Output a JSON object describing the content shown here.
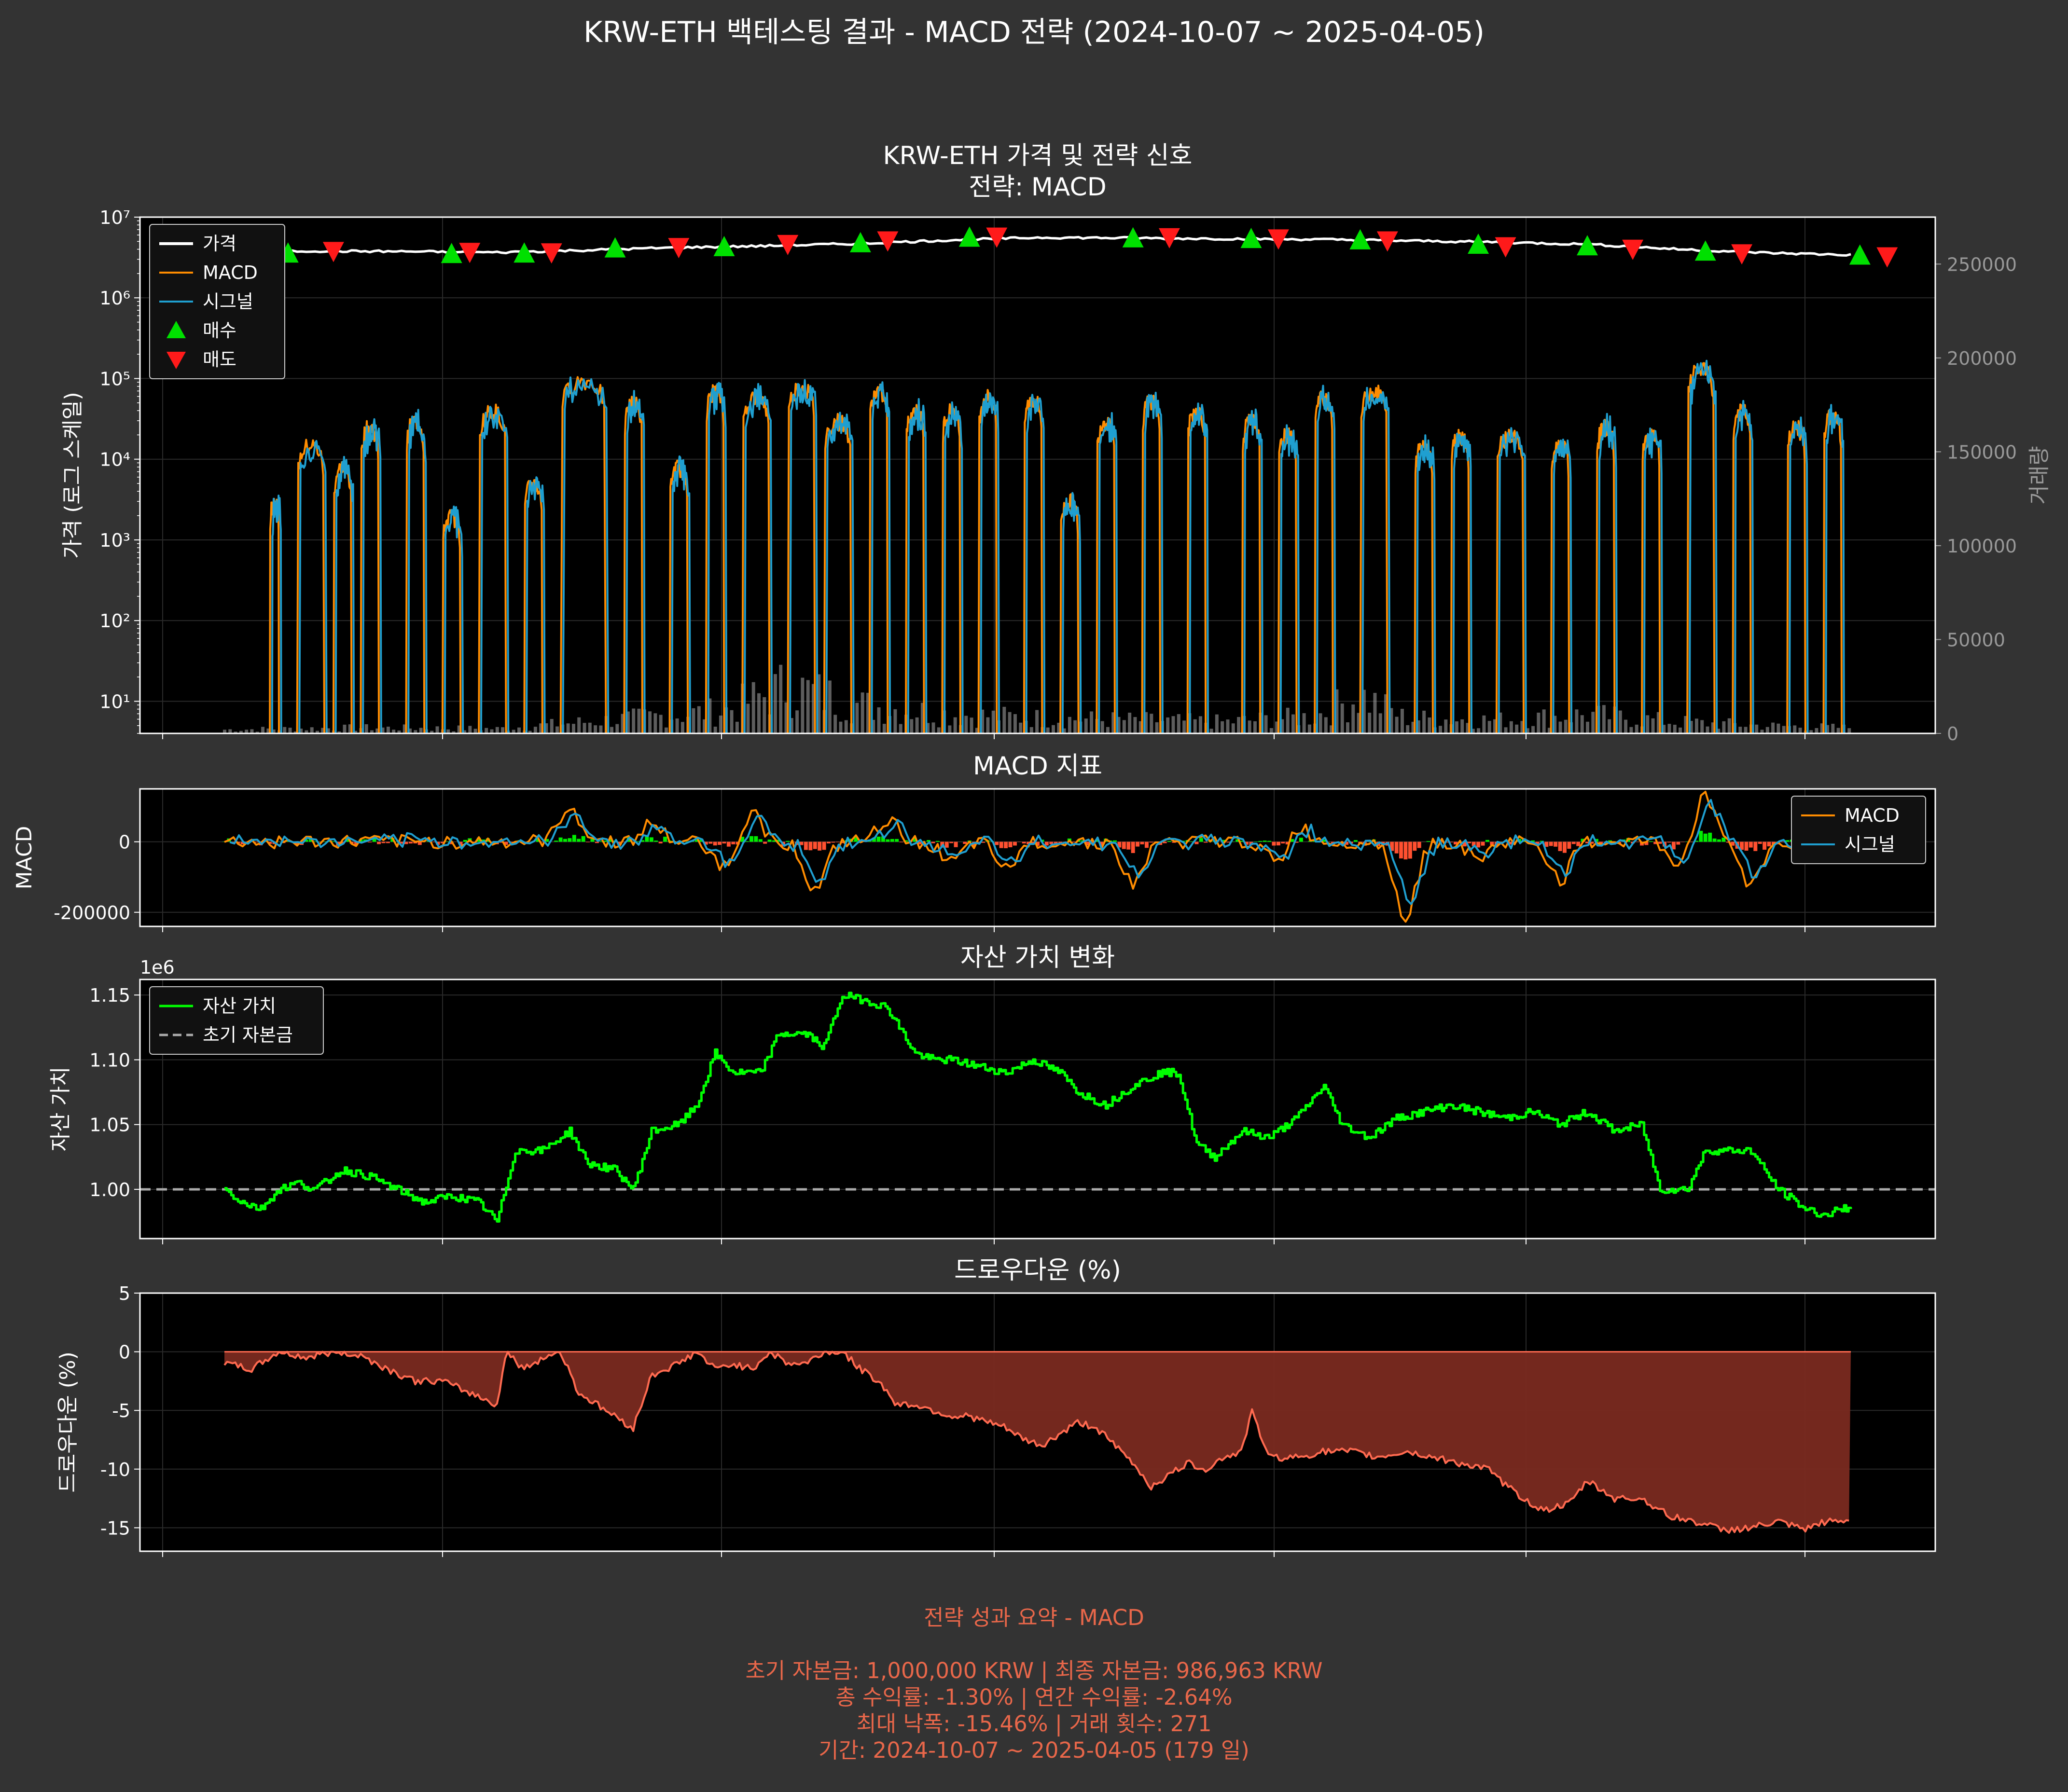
{
  "figure": {
    "title": "KRW-ETH 백테스팅 결과 - MACD 전략 (2024-10-07 ~ 2025-04-05)",
    "background": "#333333",
    "axes_background": "#000000"
  },
  "colors": {
    "price": "#ffffff",
    "macd": "#ff8c00",
    "signal": "#1f9fd0",
    "buy": "#00e000",
    "sell": "#ff1a1a",
    "equity": "#00ff00",
    "initial_capital": "#aaaaaa",
    "drawdown_line": "#ff6a50",
    "drawdown_fill": "#7a2a20",
    "hist_pos": "#00ee00",
    "hist_neg": "#ff5030",
    "volume": "#aaaaaa",
    "summary_text": "#e8674a"
  },
  "chart_data": [
    {
      "type": "line",
      "id": "price",
      "title_line1": "KRW-ETH 가격 및 전략 신호",
      "title_line2": "전략: MACD",
      "ylabel": "가격 (로그 스케일)",
      "y2label": "거래량",
      "yscale": "log",
      "ylim": [
        4,
        10000000
      ],
      "y_ticks": [
        10,
        100,
        1000,
        10000,
        100000,
        1000000,
        10000000
      ],
      "y_tick_labels": [
        "10¹",
        "10²",
        "10³",
        "10⁴",
        "10⁵",
        "10⁶",
        "10⁷"
      ],
      "y2lim": [
        0,
        275000
      ],
      "y2_ticks": [
        0,
        50000,
        100000,
        150000,
        200000,
        250000
      ],
      "y2_tick_labels": [
        "0",
        "50000",
        "100000",
        "150000",
        "200000",
        "250000"
      ],
      "legend": [
        "가격",
        "MACD",
        "시그널",
        "매수",
        "매도"
      ],
      "legend_position": "upper-left",
      "grid": true,
      "x_range": [
        0,
        179
      ],
      "price_series": [
        [
          0,
          3700000
        ],
        [
          10,
          3800000
        ],
        [
          20,
          3750000
        ],
        [
          30,
          3650000
        ],
        [
          40,
          3900000
        ],
        [
          50,
          4200000
        ],
        [
          60,
          4400000
        ],
        [
          70,
          4700000
        ],
        [
          80,
          5200000
        ],
        [
          90,
          5600000
        ],
        [
          100,
          5500000
        ],
        [
          110,
          5400000
        ],
        [
          120,
          5300000
        ],
        [
          130,
          5100000
        ],
        [
          140,
          4900000
        ],
        [
          150,
          4600000
        ],
        [
          160,
          4000000
        ],
        [
          170,
          3600000
        ],
        [
          179,
          3400000
        ]
      ],
      "buy_signals": [
        [
          7,
          3500000
        ],
        [
          25,
          3450000
        ],
        [
          33,
          3500000
        ],
        [
          43,
          4050000
        ],
        [
          55,
          4200000
        ],
        [
          70,
          4700000
        ],
        [
          82,
          5500000
        ],
        [
          100,
          5400000
        ],
        [
          113,
          5300000
        ],
        [
          125,
          5100000
        ],
        [
          138,
          4500000
        ],
        [
          150,
          4300000
        ],
        [
          163,
          3700000
        ],
        [
          180,
          3300000
        ]
      ],
      "sell_signals": [
        [
          12,
          3850000
        ],
        [
          27,
          3750000
        ],
        [
          36,
          3700000
        ],
        [
          50,
          4300000
        ],
        [
          62,
          4700000
        ],
        [
          73,
          5200000
        ],
        [
          85,
          5800000
        ],
        [
          104,
          5700000
        ],
        [
          116,
          5500000
        ],
        [
          128,
          5200000
        ],
        [
          141,
          4400000
        ],
        [
          155,
          4100000
        ],
        [
          167,
          3600000
        ],
        [
          183,
          3300000
        ]
      ],
      "macd_bursts": [
        [
          5,
          6,
          3000
        ],
        [
          8,
          11,
          15000
        ],
        [
          12,
          14,
          8000
        ],
        [
          15,
          17,
          25000
        ],
        [
          20,
          22,
          30000
        ],
        [
          24,
          26,
          2000
        ],
        [
          28,
          31,
          40000
        ],
        [
          33,
          35,
          5000
        ],
        [
          37,
          42,
          95000
        ],
        [
          44,
          46,
          50000
        ],
        [
          49,
          51,
          8000
        ],
        [
          53,
          55,
          70000
        ],
        [
          57,
          60,
          60000
        ],
        [
          62,
          65,
          80000
        ],
        [
          66,
          69,
          30000
        ],
        [
          71,
          73,
          70000
        ],
        [
          75,
          77,
          40000
        ],
        [
          79,
          81,
          40000
        ],
        [
          83,
          85,
          60000
        ],
        [
          88,
          90,
          55000
        ],
        [
          92,
          94,
          3000
        ],
        [
          96,
          98,
          30000
        ],
        [
          101,
          103,
          55000
        ],
        [
          106,
          108,
          40000
        ],
        [
          112,
          114,
          30000
        ],
        [
          116,
          118,
          20000
        ],
        [
          120,
          122,
          60000
        ],
        [
          125,
          128,
          70000
        ],
        [
          131,
          133,
          15000
        ],
        [
          135,
          137,
          20000
        ],
        [
          140,
          143,
          20000
        ],
        [
          146,
          148,
          15000
        ],
        [
          151,
          153,
          25000
        ],
        [
          156,
          158,
          20000
        ],
        [
          161,
          164,
          130000
        ],
        [
          166,
          168,
          40000
        ],
        [
          172,
          174,
          25000
        ],
        [
          176,
          178,
          35000
        ]
      ],
      "volume_profile": [
        [
          0,
          2000
        ],
        [
          15,
          3000
        ],
        [
          30,
          2500
        ],
        [
          45,
          8000
        ],
        [
          55,
          12000
        ],
        [
          62,
          25000
        ],
        [
          70,
          15000
        ],
        [
          80,
          10000
        ],
        [
          90,
          8000
        ],
        [
          100,
          7000
        ],
        [
          110,
          6000
        ],
        [
          120,
          9000
        ],
        [
          125,
          20000
        ],
        [
          130,
          8000
        ],
        [
          140,
          7000
        ],
        [
          150,
          10000
        ],
        [
          160,
          6000
        ],
        [
          170,
          4000
        ],
        [
          179,
          3000
        ]
      ]
    },
    {
      "type": "line",
      "id": "macd",
      "title": "MACD 지표",
      "ylabel": "MACD",
      "ylim": [
        -240000,
        150000
      ],
      "y_ticks": [
        0,
        -200000
      ],
      "y_tick_labels": [
        "0",
        "-200000"
      ],
      "legend": [
        "MACD",
        "시그널"
      ],
      "legend_position": "upper-right",
      "grid": true,
      "extremes": [
        [
          38,
          100000
        ],
        [
          47,
          50000
        ],
        [
          55,
          -70000
        ],
        [
          58,
          80000
        ],
        [
          65,
          -140000
        ],
        [
          73,
          60000
        ],
        [
          80,
          -60000
        ],
        [
          86,
          -80000
        ],
        [
          100,
          -120000
        ],
        [
          116,
          -70000
        ],
        [
          118,
          50000
        ],
        [
          130,
          -215000
        ],
        [
          138,
          -50000
        ],
        [
          147,
          -110000
        ],
        [
          160,
          -60000
        ],
        [
          163,
          130000
        ],
        [
          168,
          -120000
        ],
        [
          178,
          40000
        ]
      ]
    },
    {
      "type": "line",
      "id": "equity",
      "title": "자산 가치 변화",
      "ylabel": "자산 가치",
      "offset_label": "1e6",
      "ylim": [
        0.962,
        1.162
      ],
      "y_ticks": [
        1.0,
        1.05,
        1.1,
        1.15
      ],
      "y_tick_labels": [
        "1.00",
        "1.05",
        "1.10",
        "1.15"
      ],
      "legend": [
        "자산 가치",
        "초기 자본금"
      ],
      "legend_position": "upper-left",
      "initial_capital": 1.0,
      "grid": true,
      "series": [
        [
          0,
          1.0
        ],
        [
          2,
          0.99
        ],
        [
          4,
          0.985
        ],
        [
          6,
          1.0
        ],
        [
          8,
          1.005
        ],
        [
          10,
          1.0
        ],
        [
          13,
          1.015
        ],
        [
          16,
          1.01
        ],
        [
          19,
          1.0
        ],
        [
          22,
          0.99
        ],
        [
          25,
          0.995
        ],
        [
          28,
          0.99
        ],
        [
          30,
          0.975
        ],
        [
          32,
          1.03
        ],
        [
          35,
          1.03
        ],
        [
          38,
          1.045
        ],
        [
          40,
          1.02
        ],
        [
          43,
          1.015
        ],
        [
          45,
          1.0
        ],
        [
          47,
          1.045
        ],
        [
          50,
          1.05
        ],
        [
          52,
          1.065
        ],
        [
          54,
          1.105
        ],
        [
          56,
          1.09
        ],
        [
          59,
          1.09
        ],
        [
          61,
          1.12
        ],
        [
          64,
          1.12
        ],
        [
          66,
          1.11
        ],
        [
          68,
          1.15
        ],
        [
          71,
          1.145
        ],
        [
          73,
          1.14
        ],
        [
          76,
          1.105
        ],
        [
          78,
          1.1
        ],
        [
          80,
          1.1
        ],
        [
          83,
          1.095
        ],
        [
          86,
          1.09
        ],
        [
          89,
          1.1
        ],
        [
          92,
          1.09
        ],
        [
          94,
          1.075
        ],
        [
          97,
          1.065
        ],
        [
          100,
          1.08
        ],
        [
          103,
          1.09
        ],
        [
          105,
          1.09
        ],
        [
          107,
          1.035
        ],
        [
          109,
          1.025
        ],
        [
          112,
          1.045
        ],
        [
          115,
          1.04
        ],
        [
          118,
          1.055
        ],
        [
          121,
          1.08
        ],
        [
          123,
          1.05
        ],
        [
          126,
          1.04
        ],
        [
          129,
          1.055
        ],
        [
          132,
          1.06
        ],
        [
          135,
          1.065
        ],
        [
          138,
          1.06
        ],
        [
          141,
          1.055
        ],
        [
          144,
          1.06
        ],
        [
          147,
          1.05
        ],
        [
          150,
          1.06
        ],
        [
          153,
          1.045
        ],
        [
          156,
          1.05
        ],
        [
          158,
          1.0
        ],
        [
          161,
          1.0
        ],
        [
          163,
          1.03
        ],
        [
          165,
          1.03
        ],
        [
          168,
          1.03
        ],
        [
          171,
          1.0
        ],
        [
          174,
          0.985
        ],
        [
          176,
          0.98
        ],
        [
          179,
          0.987
        ]
      ]
    },
    {
      "type": "area",
      "id": "drawdown",
      "title": "드로우다운 (%)",
      "ylabel": "드로우다운 (%)",
      "ylim": [
        -17,
        5
      ],
      "y_ticks": [
        5,
        0,
        -5,
        -10,
        -15
      ],
      "y_tick_labels": [
        "5",
        "0",
        "-5",
        "-10",
        "-15"
      ],
      "grid": true,
      "series": [
        [
          0,
          -1
        ],
        [
          3,
          -1.5
        ],
        [
          6,
          0
        ],
        [
          9,
          -0.5
        ],
        [
          12,
          0
        ],
        [
          15,
          -0.3
        ],
        [
          18,
          -1.5
        ],
        [
          21,
          -2.5
        ],
        [
          24,
          -2.5
        ],
        [
          27,
          -3.5
        ],
        [
          30,
          -4.5
        ],
        [
          31,
          0
        ],
        [
          33,
          -1.5
        ],
        [
          35,
          -0.5
        ],
        [
          37,
          0
        ],
        [
          39,
          -3.5
        ],
        [
          42,
          -5
        ],
        [
          45,
          -6.5
        ],
        [
          47,
          -2
        ],
        [
          50,
          -1
        ],
        [
          52,
          0
        ],
        [
          54,
          -1.5
        ],
        [
          56,
          -1
        ],
        [
          58,
          -1.5
        ],
        [
          60,
          0
        ],
        [
          62,
          -1
        ],
        [
          64,
          -1
        ],
        [
          66,
          0
        ],
        [
          68,
          0
        ],
        [
          70,
          -1.5
        ],
        [
          72,
          -2.5
        ],
        [
          74,
          -4.5
        ],
        [
          76,
          -4.5
        ],
        [
          78,
          -5
        ],
        [
          80,
          -5.5
        ],
        [
          82,
          -5.5
        ],
        [
          84,
          -6
        ],
        [
          86,
          -6.5
        ],
        [
          88,
          -7.5
        ],
        [
          90,
          -8
        ],
        [
          92,
          -7
        ],
        [
          94,
          -6
        ],
        [
          96,
          -6.5
        ],
        [
          98,
          -8
        ],
        [
          100,
          -9.5
        ],
        [
          102,
          -11.5
        ],
        [
          104,
          -10.5
        ],
        [
          106,
          -9.5
        ],
        [
          108,
          -10
        ],
        [
          110,
          -9
        ],
        [
          112,
          -8.5
        ],
        [
          113,
          -5
        ],
        [
          115,
          -9
        ],
        [
          118,
          -9
        ],
        [
          121,
          -8.5
        ],
        [
          124,
          -8.5
        ],
        [
          127,
          -9
        ],
        [
          130,
          -8.5
        ],
        [
          133,
          -9
        ],
        [
          136,
          -9.5
        ],
        [
          139,
          -10
        ],
        [
          142,
          -12
        ],
        [
          145,
          -13.5
        ],
        [
          148,
          -13
        ],
        [
          150,
          -11
        ],
        [
          153,
          -12.5
        ],
        [
          156,
          -12.5
        ],
        [
          159,
          -14
        ],
        [
          162,
          -14.5
        ],
        [
          165,
          -15.2
        ],
        [
          168,
          -15
        ],
        [
          171,
          -14.5
        ],
        [
          174,
          -15.2
        ],
        [
          176,
          -14.5
        ],
        [
          179,
          -14.4
        ]
      ]
    }
  ],
  "summary": {
    "title": "전략 성과 요약 - MACD",
    "line1": "초기 자본금: 1,000,000 KRW | 최종 자본금: 986,963 KRW",
    "line2": "총 수익률: -1.30% | 연간 수익률: -2.64%",
    "line3": "최대 낙폭: -15.46% | 거래 횟수: 271",
    "line4": "기간: 2024-10-07 ~ 2025-04-05 (179 일)"
  }
}
